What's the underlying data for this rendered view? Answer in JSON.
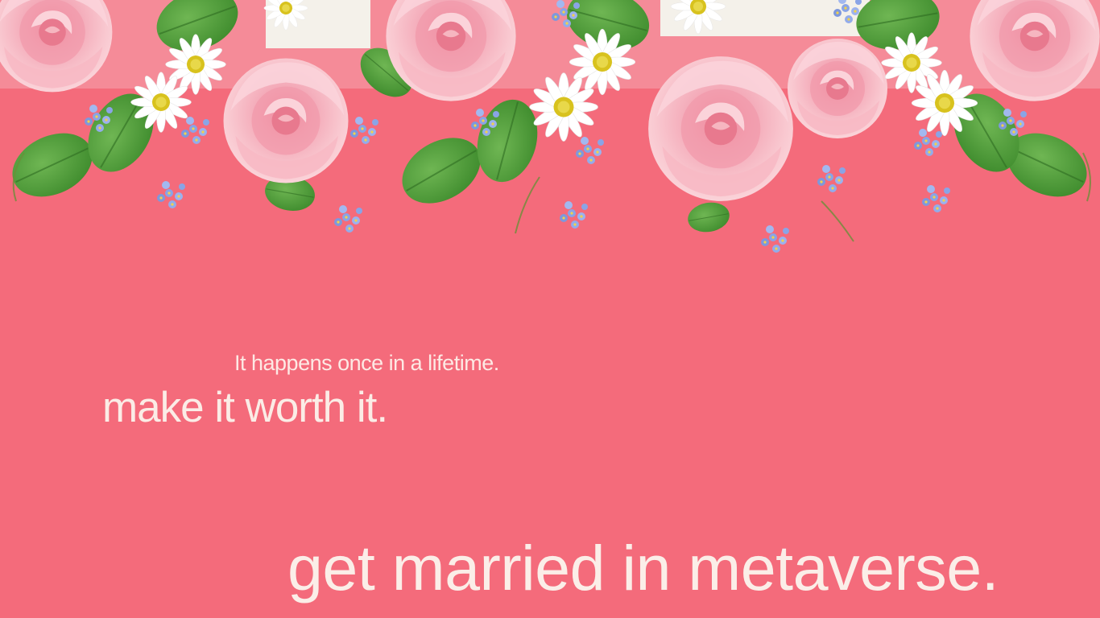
{
  "poster": {
    "tagline": "It happens once in a lifetime.",
    "subhead": "make it worth it.",
    "headline": "get married in metaverse."
  },
  "colors": {
    "background": "#f46b7b",
    "text": "#fbeee8",
    "rose": "#f6b6c0",
    "leaf": "#4e9a3a",
    "daisy": "#ffffff",
    "forget_me_not": "#8aa4e6"
  },
  "decor": {
    "floral_border": "pink-roses-daisies-forget-me-nots-garland"
  }
}
